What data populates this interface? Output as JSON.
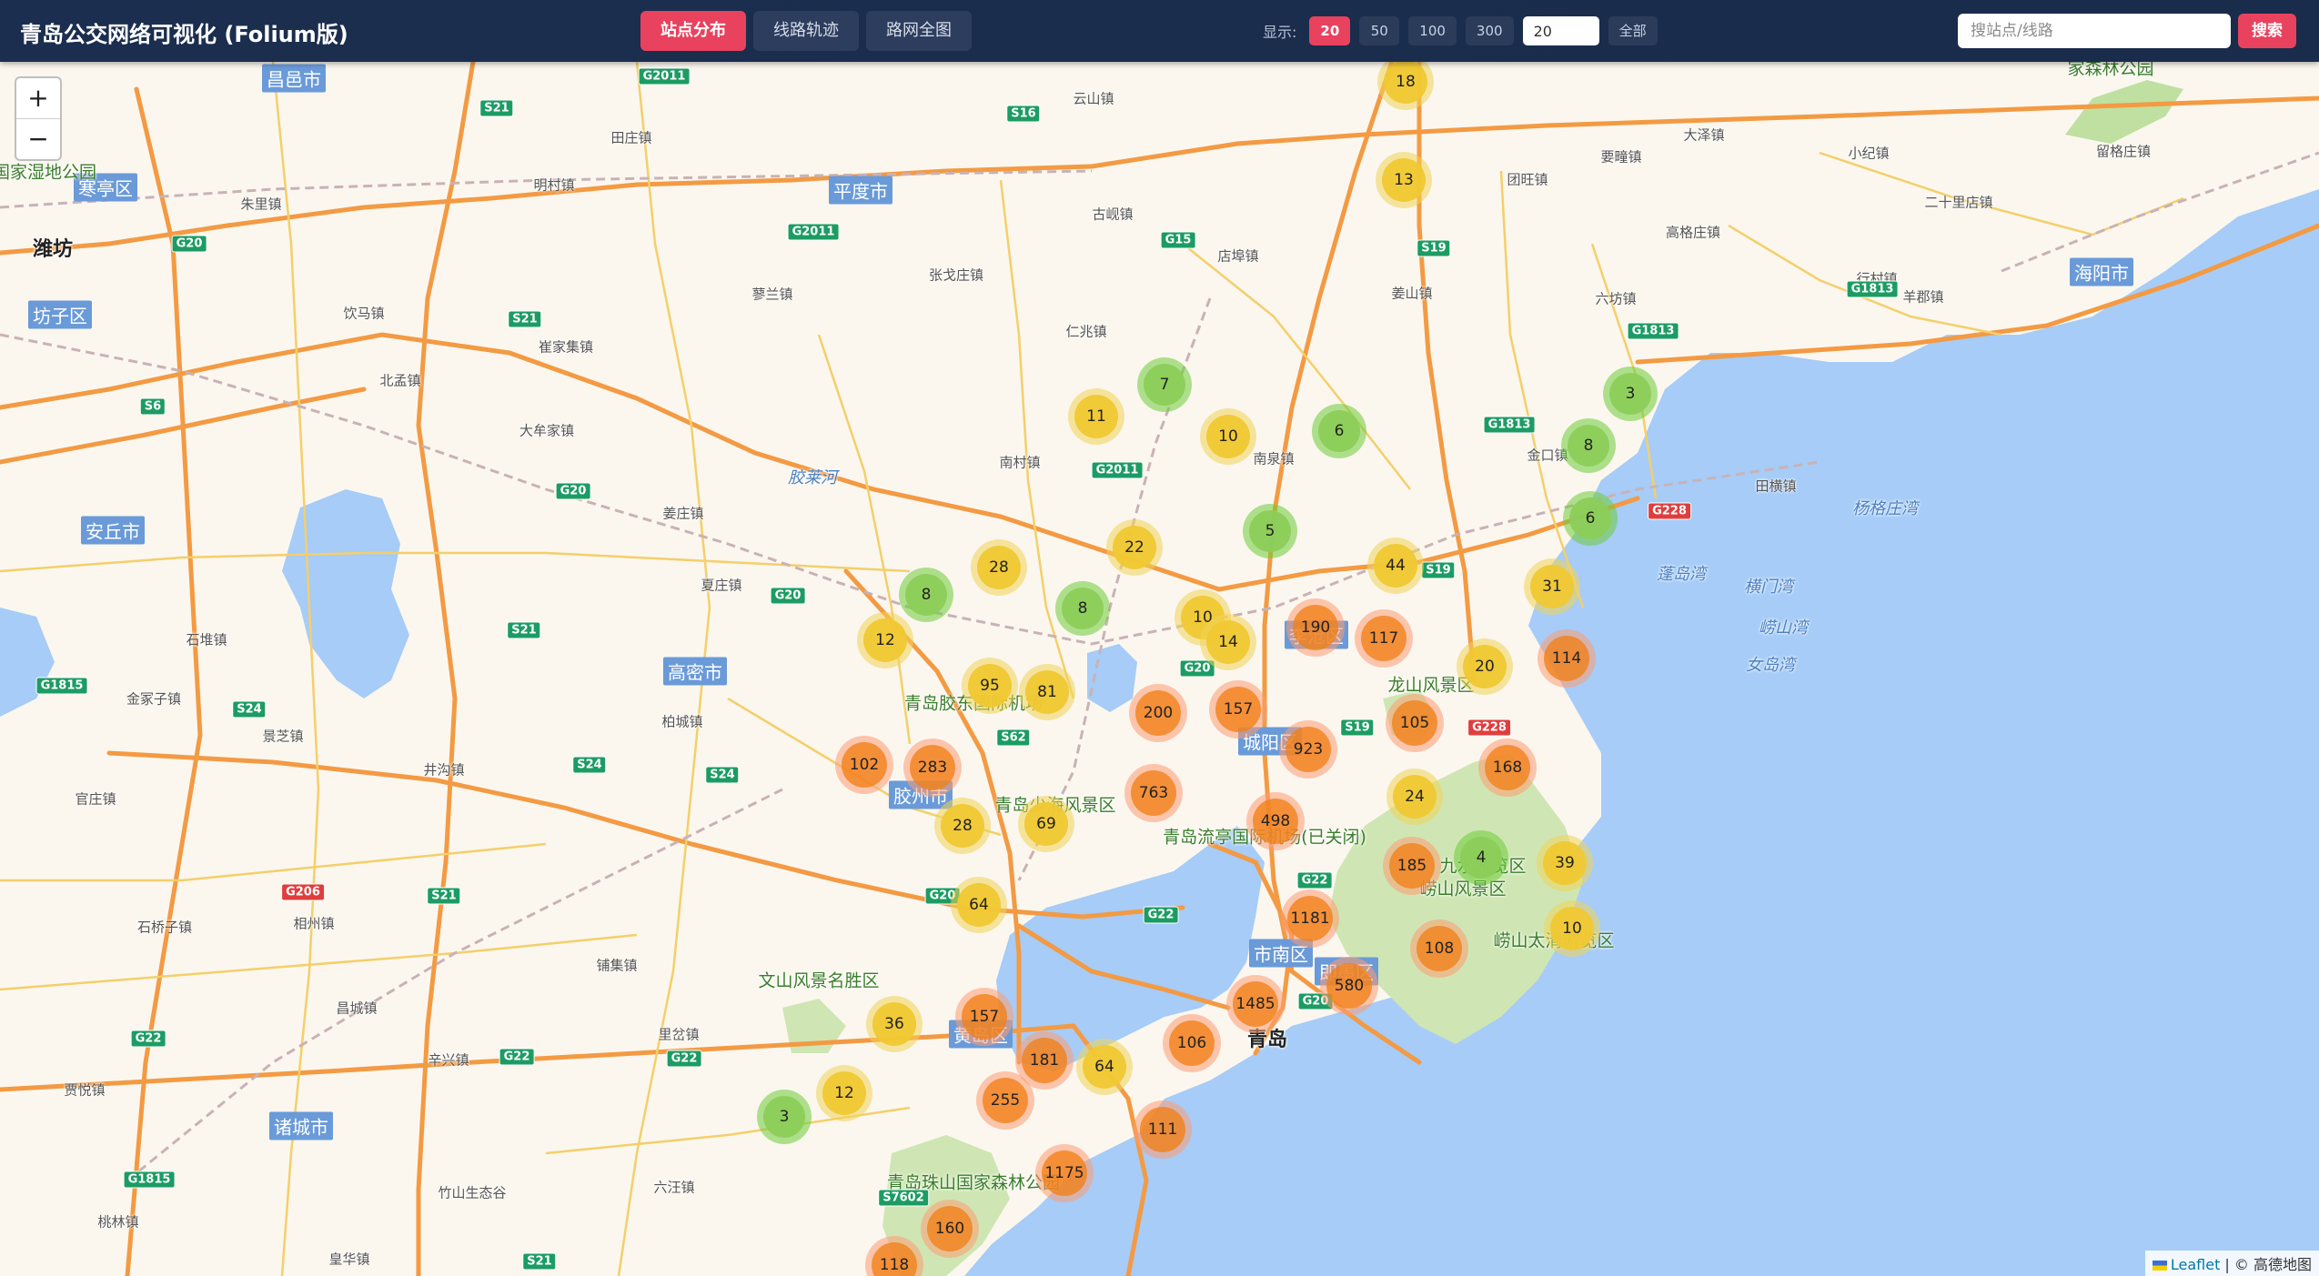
{
  "header": {
    "title": "青岛公交网络可视化 (Folium版)",
    "tabs": [
      {
        "label": "站点分布",
        "active": true
      },
      {
        "label": "线路轨迹",
        "active": false
      },
      {
        "label": "路网全图",
        "active": false
      }
    ],
    "show_label": "显示:",
    "count_options": [
      {
        "label": "20",
        "active": true
      },
      {
        "label": "50",
        "active": false
      },
      {
        "label": "100",
        "active": false
      },
      {
        "label": "300",
        "active": false
      }
    ],
    "count_input_value": "20",
    "all_label": "全部",
    "search_placeholder": "搜站点/线路",
    "search_label": "搜索"
  },
  "map": {
    "zoom_in": "+",
    "zoom_out": "−",
    "attribution_leaflet": "Leaflet",
    "attribution_rest": " | © 高德地图",
    "cluster_colors": {
      "small": "#8ccd5a",
      "medium": "#f0c832",
      "large": "#f18017"
    },
    "clusters": [
      {
        "count": "18",
        "size": "medium"
      },
      {
        "count": "13",
        "size": "medium"
      },
      {
        "count": "7",
        "size": "small"
      },
      {
        "count": "11",
        "size": "medium"
      },
      {
        "count": "10",
        "size": "medium"
      },
      {
        "count": "6",
        "size": "small"
      },
      {
        "count": "3",
        "size": "small"
      },
      {
        "count": "8",
        "size": "small"
      },
      {
        "count": "6",
        "size": "small"
      },
      {
        "count": "5",
        "size": "small"
      },
      {
        "count": "28",
        "size": "medium"
      },
      {
        "count": "22",
        "size": "medium"
      },
      {
        "count": "44",
        "size": "medium"
      },
      {
        "count": "31",
        "size": "medium"
      },
      {
        "count": "8",
        "size": "small"
      },
      {
        "count": "8",
        "size": "small"
      },
      {
        "count": "12",
        "size": "medium"
      },
      {
        "count": "10",
        "size": "medium"
      },
      {
        "count": "14",
        "size": "medium"
      },
      {
        "count": "190",
        "size": "large"
      },
      {
        "count": "117",
        "size": "large"
      },
      {
        "count": "114",
        "size": "large"
      },
      {
        "count": "20",
        "size": "medium"
      },
      {
        "count": "95",
        "size": "medium"
      },
      {
        "count": "81",
        "size": "medium"
      },
      {
        "count": "200",
        "size": "large"
      },
      {
        "count": "157",
        "size": "large"
      },
      {
        "count": "105",
        "size": "large"
      },
      {
        "count": "923",
        "size": "large"
      },
      {
        "count": "168",
        "size": "large"
      },
      {
        "count": "102",
        "size": "large"
      },
      {
        "count": "283",
        "size": "large"
      },
      {
        "count": "763",
        "size": "large"
      },
      {
        "count": "24",
        "size": "medium"
      },
      {
        "count": "28",
        "size": "medium"
      },
      {
        "count": "69",
        "size": "medium"
      },
      {
        "count": "498",
        "size": "large"
      },
      {
        "count": "185",
        "size": "large"
      },
      {
        "count": "4",
        "size": "small"
      },
      {
        "count": "39",
        "size": "medium"
      },
      {
        "count": "64",
        "size": "medium"
      },
      {
        "count": "1181",
        "size": "large"
      },
      {
        "count": "108",
        "size": "large"
      },
      {
        "count": "10",
        "size": "medium"
      },
      {
        "count": "580",
        "size": "large"
      },
      {
        "count": "36",
        "size": "medium"
      },
      {
        "count": "157",
        "size": "large"
      },
      {
        "count": "1485",
        "size": "large"
      },
      {
        "count": "181",
        "size": "large"
      },
      {
        "count": "64",
        "size": "medium"
      },
      {
        "count": "106",
        "size": "large"
      },
      {
        "count": "12",
        "size": "medium"
      },
      {
        "count": "255",
        "size": "large"
      },
      {
        "count": "3",
        "size": "small"
      },
      {
        "count": "111",
        "size": "large"
      },
      {
        "count": "1175",
        "size": "large"
      },
      {
        "count": "160",
        "size": "large"
      },
      {
        "count": "118",
        "size": "large"
      }
    ],
    "places": [
      {
        "text": "潍坊",
        "kind": "city"
      },
      {
        "text": "昌邑市",
        "kind": "district"
      },
      {
        "text": "寒亭区",
        "kind": "district"
      },
      {
        "text": "坊子区",
        "kind": "district"
      },
      {
        "text": "安丘市",
        "kind": "district"
      },
      {
        "text": "平度市",
        "kind": "district"
      },
      {
        "text": "高密市",
        "kind": "district"
      },
      {
        "text": "胶州市",
        "kind": "district"
      },
      {
        "text": "诸城市",
        "kind": "district"
      },
      {
        "text": "海阳市",
        "kind": "district"
      },
      {
        "text": "城阳区",
        "kind": "district"
      },
      {
        "text": "青岛",
        "kind": "city"
      },
      {
        "text": "胶莱河",
        "kind": "water"
      },
      {
        "text": "蓬岛湾",
        "kind": "water"
      },
      {
        "text": "横门湾",
        "kind": "water"
      },
      {
        "text": "崂山湾",
        "kind": "water"
      },
      {
        "text": "女岛湾",
        "kind": "water"
      },
      {
        "text": "杨格庄湾",
        "kind": "water"
      },
      {
        "text": "龙山风景区",
        "kind": "scenic"
      },
      {
        "text": "崂山风景区",
        "kind": "scenic"
      },
      {
        "text": "文山风景名胜区",
        "kind": "scenic"
      },
      {
        "text": "青岛珠山国家森林公园",
        "kind": "scenic"
      },
      {
        "text": "青岛胶东国际机场",
        "kind": "scenic"
      },
      {
        "text": "青岛流亭国际机场(已关闭)",
        "kind": "scenic"
      },
      {
        "text": "青岛少海风景区",
        "kind": "scenic"
      },
      {
        "text": "竹山生态谷",
        "kind": "town"
      },
      {
        "text": "明村镇",
        "kind": "town"
      },
      {
        "text": "田庄镇",
        "kind": "town"
      },
      {
        "text": "云山镇",
        "kind": "town"
      },
      {
        "text": "古岘镇",
        "kind": "town"
      },
      {
        "text": "店埠镇",
        "kind": "town"
      },
      {
        "text": "仁兆镇",
        "kind": "town"
      },
      {
        "text": "南村镇",
        "kind": "town"
      },
      {
        "text": "蓼兰镇",
        "kind": "town"
      },
      {
        "text": "张戈庄镇",
        "kind": "town"
      },
      {
        "text": "崔家集镇",
        "kind": "town"
      },
      {
        "text": "北孟镇",
        "kind": "town"
      },
      {
        "text": "饮马镇",
        "kind": "town"
      },
      {
        "text": "大牟家镇",
        "kind": "town"
      },
      {
        "text": "姜庄镇",
        "kind": "town"
      },
      {
        "text": "夏庄镇",
        "kind": "town"
      },
      {
        "text": "柏城镇",
        "kind": "town"
      },
      {
        "text": "井沟镇",
        "kind": "town"
      },
      {
        "text": "景芝镇",
        "kind": "town"
      },
      {
        "text": "石堆镇",
        "kind": "town"
      },
      {
        "text": "金冢子镇",
        "kind": "town"
      },
      {
        "text": "官庄镇",
        "kind": "town"
      },
      {
        "text": "石桥子镇",
        "kind": "town"
      },
      {
        "text": "相州镇",
        "kind": "town"
      },
      {
        "text": "昌城镇",
        "kind": "town"
      },
      {
        "text": "辛兴镇",
        "kind": "town"
      },
      {
        "text": "贾悦镇",
        "kind": "town"
      },
      {
        "text": "铺集镇",
        "kind": "town"
      },
      {
        "text": "里岔镇",
        "kind": "town"
      },
      {
        "text": "六汪镇",
        "kind": "town"
      },
      {
        "text": "桃林镇",
        "kind": "town"
      },
      {
        "text": "皇华镇",
        "kind": "town"
      },
      {
        "text": "大泽镇",
        "kind": "town"
      },
      {
        "text": "小纪镇",
        "kind": "town"
      },
      {
        "text": "留格庄镇",
        "kind": "town"
      },
      {
        "text": "二十里店镇",
        "kind": "town"
      },
      {
        "text": "高格庄镇",
        "kind": "town"
      },
      {
        "text": "行村镇",
        "kind": "town"
      },
      {
        "text": "羊郡镇",
        "kind": "town"
      },
      {
        "text": "六坊镇",
        "kind": "town"
      },
      {
        "text": "团旺镇",
        "kind": "town"
      },
      {
        "text": "要疃镇",
        "kind": "town"
      },
      {
        "text": "姜山镇",
        "kind": "town"
      },
      {
        "text": "金口镇",
        "kind": "town"
      },
      {
        "text": "田横镇",
        "kind": "town"
      },
      {
        "text": "朱里镇",
        "kind": "town"
      },
      {
        "text": "泊河国家湿地公园",
        "kind": "scenic"
      },
      {
        "text": "家森林公园",
        "kind": "scenic"
      },
      {
        "text": "南泉镇",
        "kind": "town"
      },
      {
        "text": "九水游览区",
        "kind": "scenic"
      },
      {
        "text": "崂山太清游览区",
        "kind": "scenic"
      },
      {
        "text": "李沧区",
        "kind": "district"
      },
      {
        "text": "市南区",
        "kind": "district"
      },
      {
        "text": "黄岛区",
        "kind": "district"
      },
      {
        "text": "即墨区",
        "kind": "district"
      }
    ],
    "shields": [
      "G2011",
      "S21",
      "S16",
      "G20",
      "G2011",
      "G15",
      "S19",
      "G1813",
      "G1813",
      "G1813",
      "S6",
      "G20",
      "S21",
      "G20",
      "S19",
      "G228",
      "S21",
      "G1815",
      "S24",
      "S24",
      "S24",
      "S62",
      "G20",
      "S19",
      "G228",
      "G206",
      "S21",
      "G22",
      "G22",
      "G22",
      "G22",
      "G22",
      "G1815",
      "S21",
      "G20",
      "S7602",
      "G2011",
      "G20"
    ]
  }
}
